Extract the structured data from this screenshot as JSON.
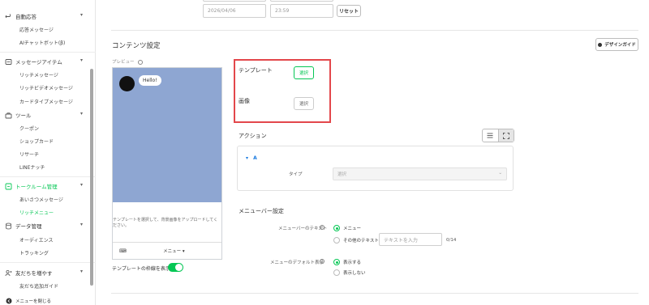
{
  "sidebar": {
    "sections": [
      {
        "label": "自動応答",
        "items": [
          "応答メッセージ",
          "AIチャットボット(β)"
        ]
      },
      {
        "label": "メッセージアイテム",
        "items": [
          "リッチメッセージ",
          "リッチビデオメッセージ",
          "カードタイプメッセージ"
        ]
      },
      {
        "label": "ツール",
        "items": [
          "クーポン",
          "ショップカード",
          "リサーチ",
          "LINEナッチ"
        ]
      },
      {
        "label": "トークルーム管理",
        "items": [
          "あいさつメッセージ",
          "リッチメニュー"
        ]
      },
      {
        "label": "データ管理",
        "items": [
          "オーディエンス",
          "トラッキング"
        ]
      },
      {
        "label": "友だちを増やす",
        "items": [
          "友だち追加ガイド"
        ]
      }
    ],
    "footer": "メニューを閉じる"
  },
  "period": {
    "date_value": "2026/04/06",
    "time_value": "23:59",
    "reset_label": "リセット"
  },
  "content": {
    "title": "コンテンツ設定",
    "design_guide_label": "デザインガイド",
    "preview_label": "プレビュー",
    "chat_bubble": "Hello!",
    "richmenu_help": "テンプレートを選択して、背景画像をアップロードしてください。",
    "menubar_text": "メニュー ▾",
    "show_frame_label": "テンプレートの枠線を表示",
    "template_label": "テンプレート",
    "template_button": "選択",
    "image_label": "画像",
    "image_button": "選択"
  },
  "action": {
    "title": "アクション",
    "item_label": "A",
    "type_label": "タイプ",
    "type_placeholder": "選択"
  },
  "menubar_settings": {
    "title": "メニューバー設定",
    "text_label": "メニューバーのテキスト",
    "option_menu": "メニュー",
    "option_other": "その他のテキスト",
    "text_placeholder": "テキストを入力",
    "char_count": "0/14",
    "default_label": "メニューのデフォルト表示",
    "option_show": "表示する",
    "option_hide": "表示しない"
  },
  "colors": {
    "accent": "#06c755",
    "highlight": "#e3474b",
    "preview_bg": "#8ea6d2"
  }
}
